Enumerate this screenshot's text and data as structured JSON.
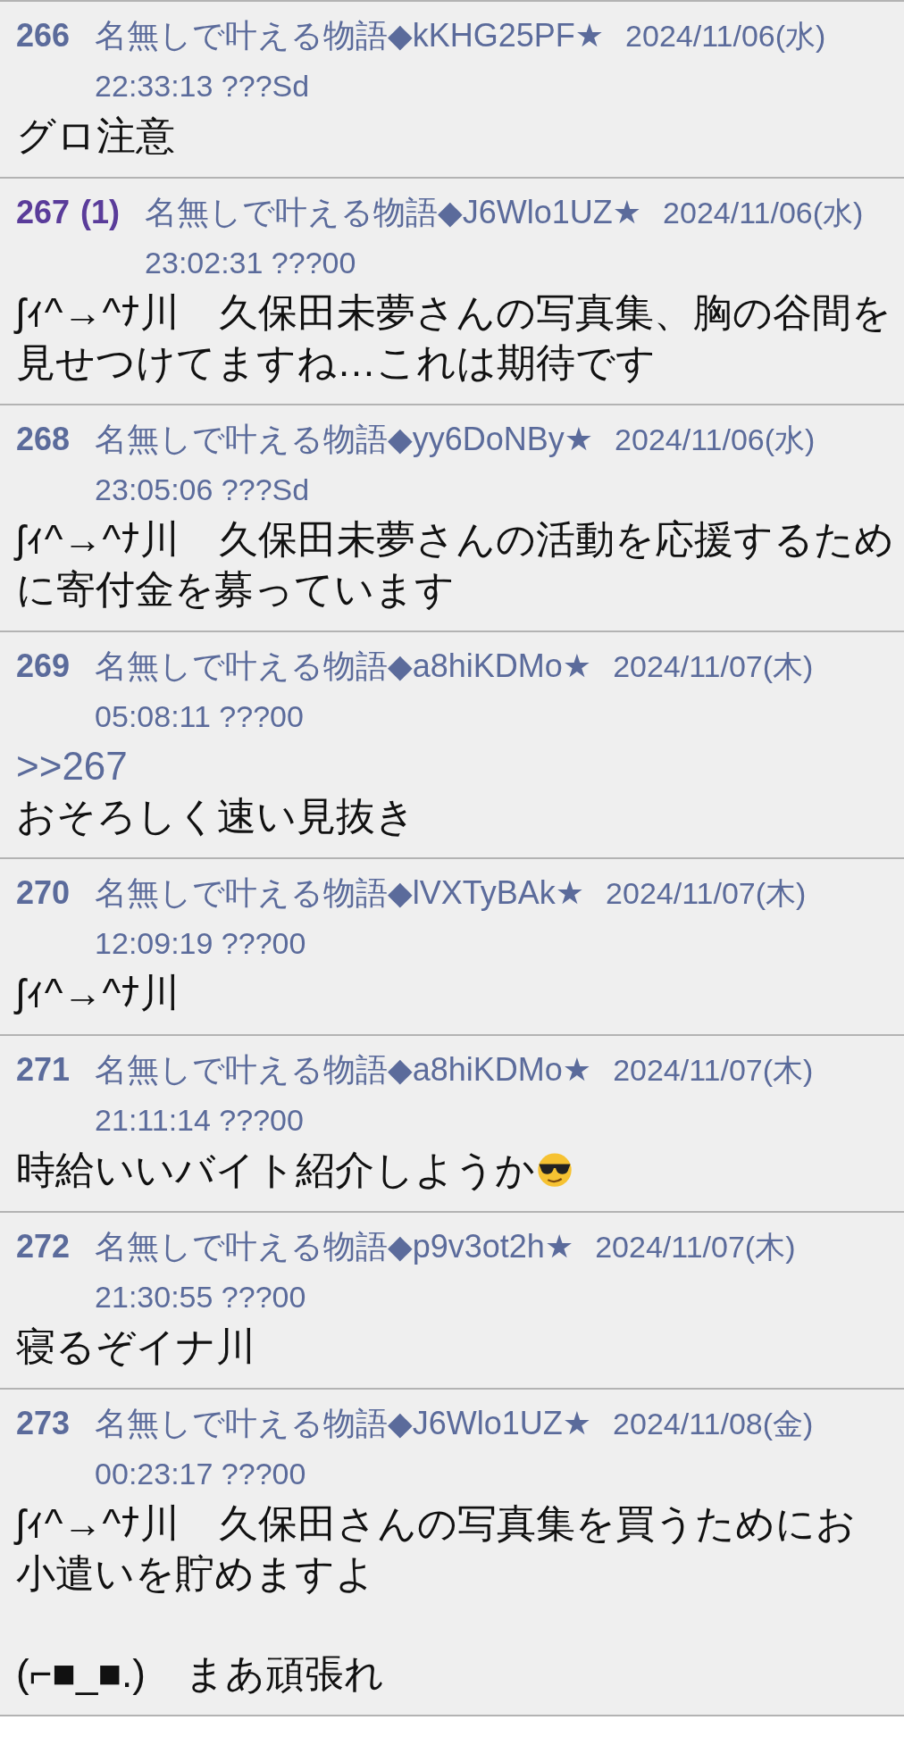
{
  "posts": [
    {
      "number": "266",
      "name": "名無しで叶える物語◆kKHG25PF★",
      "date": "2024/11/06(水)",
      "time": "22:33:13 ???Sd",
      "body": [
        {
          "kind": "text",
          "text": "グロ注意"
        }
      ]
    },
    {
      "number": "267",
      "replies": "(1)",
      "name": "名無しで叶える物語◆J6Wlo1UZ★",
      "date": "2024/11/06(水)",
      "time": "23:02:31 ???00",
      "body": [
        {
          "kind": "text",
          "text": "ʃｨ^→^ﾅ川　久保田未夢さんの写真集、胸の谷間を見せつけてますね…これは期待です"
        }
      ]
    },
    {
      "number": "268",
      "name": "名無しで叶える物語◆yy6DoNBy★",
      "date": "2024/11/06(水)",
      "time": "23:05:06 ???Sd",
      "body": [
        {
          "kind": "text",
          "text": "ʃｨ^→^ﾅ川　久保田未夢さんの活動を応援するために寄付金を募っています"
        }
      ]
    },
    {
      "number": "269",
      "name": "名無しで叶える物語◆a8hiKDMo★",
      "date": "2024/11/07(木)",
      "time": "05:08:11 ???00",
      "body": [
        {
          "kind": "anchor",
          "text": ">>267"
        },
        {
          "kind": "text",
          "text": "おそろしく速い見抜き"
        }
      ]
    },
    {
      "number": "270",
      "name": "名無しで叶える物語◆lVXTyBAk★",
      "date": "2024/11/07(木)",
      "time": "12:09:19 ???00",
      "body": [
        {
          "kind": "text",
          "text": "ʃｨ^→^ﾅ川"
        }
      ]
    },
    {
      "number": "271",
      "name": "名無しで叶える物語◆a8hiKDMo★",
      "date": "2024/11/07(木)",
      "time": "21:11:14 ???00",
      "body": [
        {
          "kind": "text",
          "text": "時給いいバイト紹介しようか",
          "emoji": true
        }
      ]
    },
    {
      "number": "272",
      "name": "名無しで叶える物語◆p9v3ot2h★",
      "date": "2024/11/07(木)",
      "time": "21:30:55 ???00",
      "body": [
        {
          "kind": "text",
          "text": "寝るぞイナ川"
        }
      ]
    },
    {
      "number": "273",
      "name": "名無しで叶える物語◆J6Wlo1UZ★",
      "date": "2024/11/08(金)",
      "time": "00:23:17 ???00",
      "body": [
        {
          "kind": "text",
          "text": "ʃｨ^→^ﾅ川　久保田さんの写真集を買うためにお小遣いを貯めますよ"
        },
        {
          "kind": "text",
          "gap": true,
          "text": "(⌐■_■.)　まあ頑張れ"
        }
      ]
    }
  ]
}
